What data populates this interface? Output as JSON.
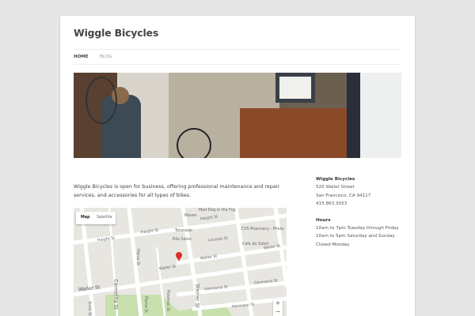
{
  "site": {
    "title": "Wiggle Bicycles"
  },
  "nav": {
    "items": [
      {
        "label": "Home",
        "active": true
      },
      {
        "label": "Blog",
        "active": false
      }
    ]
  },
  "intro": "Wiggle Bicycles is open for business, offering professional maintenance and repair services, and accessories for all types of bikes.",
  "map": {
    "type_buttons": [
      "Map",
      "Satellite"
    ],
    "zoom_in": "+",
    "zoom_out": "−",
    "labels": {
      "haight1": "Haight St",
      "haight2": "Haight St",
      "haight3": "Haight St",
      "waller1": "Waller St",
      "waller2": "Waller St",
      "waller3": "Waller St",
      "waller4": "Waller St",
      "germania1": "Germania St",
      "germania2": "Germania St",
      "hermann": "Hermann St",
      "laussat": "Laussat St",
      "pierce1": "Pierce St",
      "pierce2": "Pierce St",
      "steiner": "Steiner St",
      "scott": "Scott St",
      "carmelita": "Carmelita St",
      "potomac": "Potomac St",
      "maven": "Maven",
      "maddog": "Mad Dog in the Fog",
      "toronado": "Toronado",
      "edo": "Edo Salon",
      "cvs": "CVS Pharmacy - Photo",
      "cafe": "Cafe du Soleil"
    }
  },
  "sidebar": {
    "name": "Wiggle Bicycles",
    "street": "520 Waller Street",
    "city": "San Francisco, CA 94117",
    "phone": "415.863.3033",
    "hours_title": "Hours",
    "hours": [
      "10am to 7pm Tuesday through Friday",
      "10am to 5pm Saturday and Sunday",
      "Closed Monday"
    ]
  },
  "colors": {
    "accent": "#21759b",
    "park": "#c8dfae",
    "pin": "#d93025"
  }
}
